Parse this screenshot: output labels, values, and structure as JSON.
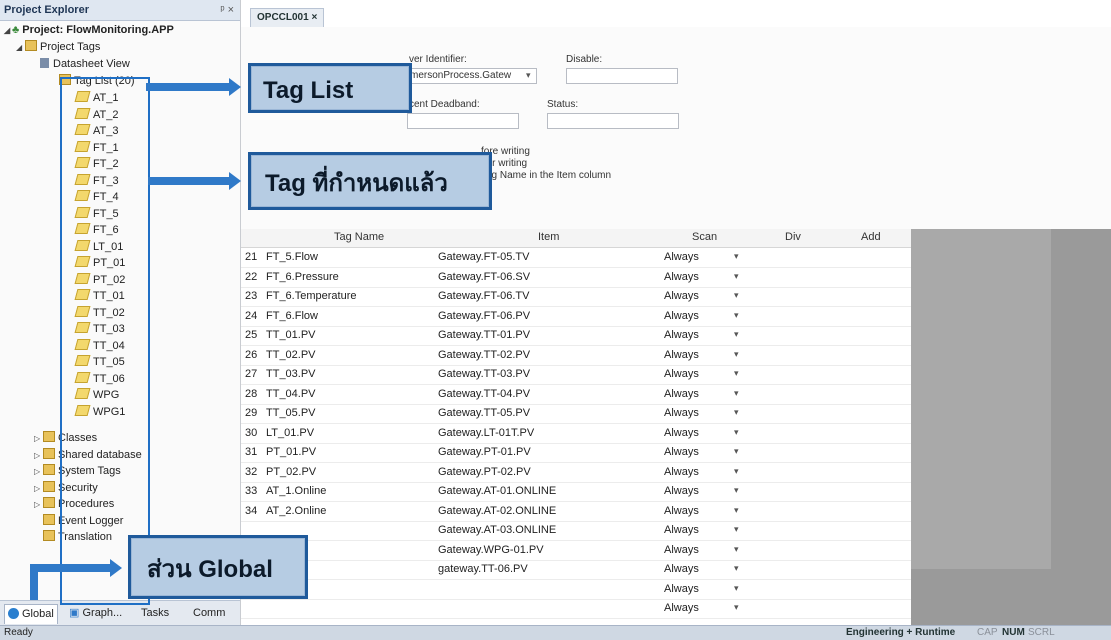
{
  "explorer": {
    "title": "Project Explorer",
    "pin": "ᵖ ×",
    "project": "Project: FlowMonitoring.APP",
    "project_tags": "Project Tags",
    "datasheet": "Datasheet View",
    "tag_list": "Tag List (20)",
    "tags": [
      "AT_1",
      "AT_2",
      "AT_3",
      "FT_1",
      "FT_2",
      "FT_3",
      "FT_4",
      "FT_5",
      "FT_6",
      "LT_01",
      "PT_01",
      "PT_02",
      "TT_01",
      "TT_02",
      "TT_03",
      "TT_04",
      "TT_05",
      "TT_06",
      "WPG",
      "WPG1"
    ],
    "folders": [
      "Classes",
      "Shared database",
      "System Tags",
      "Security",
      "Procedures",
      "Event Logger",
      "Translation"
    ],
    "tabs": {
      "global": "Global",
      "graph": "Graph...",
      "tasks": "Tasks",
      "comm": "Comm"
    }
  },
  "document": {
    "tab": "OPCCL001 ×",
    "server_identifier_label": "ver Identifier:",
    "server_value": "mersonProcess.Gatew",
    "disable_label": "Disable:",
    "deadband_label": "cent Deadband:",
    "status_label": "Status:",
    "opt1": "fore writing",
    "opt2": "fter writing",
    "opt3": "Tag Name in the Item column"
  },
  "grid": {
    "headers": {
      "tag": "Tag Name",
      "item": "Item",
      "scan": "Scan",
      "div": "Div",
      "add": "Add"
    },
    "rows": [
      {
        "n": "21",
        "tag": "FT_5.Flow",
        "item": "Gateway.FT-05.TV",
        "scan": "Always"
      },
      {
        "n": "22",
        "tag": "FT_6.Pressure",
        "item": "Gateway.FT-06.SV",
        "scan": "Always"
      },
      {
        "n": "23",
        "tag": "FT_6.Temperature",
        "item": "Gateway.FT-06.TV",
        "scan": "Always"
      },
      {
        "n": "24",
        "tag": "FT_6.Flow",
        "item": "Gateway.FT-06.PV",
        "scan": "Always"
      },
      {
        "n": "25",
        "tag": "TT_01.PV",
        "item": "Gateway.TT-01.PV",
        "scan": "Always"
      },
      {
        "n": "26",
        "tag": "TT_02.PV",
        "item": "Gateway.TT-02.PV",
        "scan": "Always"
      },
      {
        "n": "27",
        "tag": "TT_03.PV",
        "item": "Gateway.TT-03.PV",
        "scan": "Always"
      },
      {
        "n": "28",
        "tag": "TT_04.PV",
        "item": "Gateway.TT-04.PV",
        "scan": "Always"
      },
      {
        "n": "29",
        "tag": "TT_05.PV",
        "item": "Gateway.TT-05.PV",
        "scan": "Always"
      },
      {
        "n": "30",
        "tag": "LT_01.PV",
        "item": "Gateway.LT-01T.PV",
        "scan": "Always"
      },
      {
        "n": "31",
        "tag": "PT_01.PV",
        "item": "Gateway.PT-01.PV",
        "scan": "Always"
      },
      {
        "n": "32",
        "tag": "PT_02.PV",
        "item": "Gateway.PT-02.PV",
        "scan": "Always"
      },
      {
        "n": "33",
        "tag": "AT_1.Online",
        "item": "Gateway.AT-01.ONLINE",
        "scan": "Always"
      },
      {
        "n": "34",
        "tag": "AT_2.Online",
        "item": "Gateway.AT-02.ONLINE",
        "scan": "Always"
      },
      {
        "n": "",
        "tag": "",
        "item": "Gateway.AT-03.ONLINE",
        "scan": "Always"
      },
      {
        "n": "",
        "tag": "",
        "item": "Gateway.WPG-01.PV",
        "scan": "Always"
      },
      {
        "n": "",
        "tag": "",
        "item": "gateway.TT-06.PV",
        "scan": "Always"
      },
      {
        "n": "",
        "tag": "",
        "item": "",
        "scan": "Always"
      },
      {
        "n": "",
        "tag": "",
        "item": "",
        "scan": "Always"
      }
    ]
  },
  "status": {
    "ready": "Ready",
    "mode": "Engineering + Runtime",
    "cap": "CAP",
    "num": "NUM",
    "scrl": "SCRL"
  },
  "callouts": {
    "tag_list": "Tag List",
    "tag_defined": "Tag ที่กำหนดแล้ว",
    "global": "ส่วน Global"
  },
  "colors": {
    "callout_fill": "#b6cce3",
    "callout_border": "#1f5a9b",
    "arrow": "#2f79c8"
  }
}
